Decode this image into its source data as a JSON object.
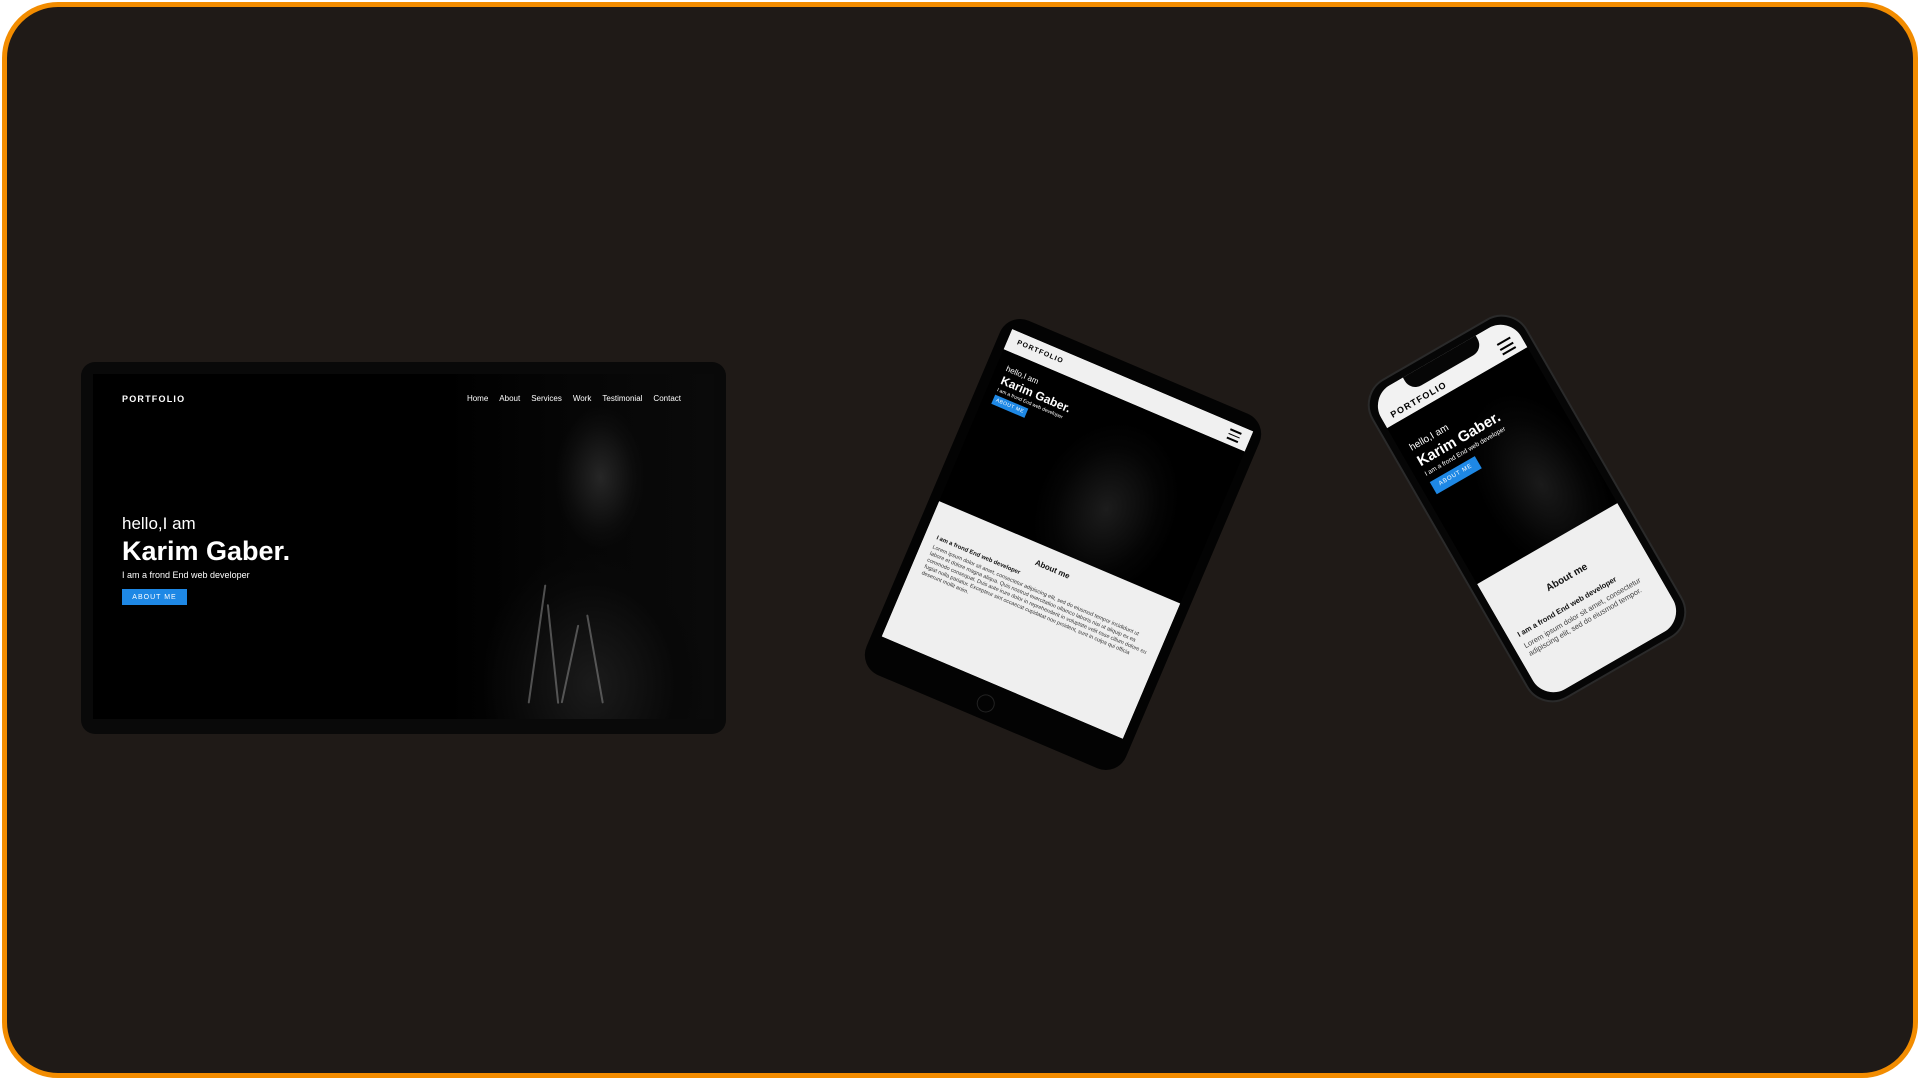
{
  "colors": {
    "frame_border": "#f28c00",
    "background": "#1f1a17",
    "accent": "#1e88e5"
  },
  "desktop": {
    "logo": "PORTFOLIO",
    "nav": [
      "Home",
      "About",
      "Services",
      "Work",
      "Testimonial",
      "Contact"
    ],
    "greeting": "hello,I am",
    "name": "Karim Gaber.",
    "subtitle": "I am a frond End web developer",
    "button": "ABOUT ME"
  },
  "tablet": {
    "logo": "PORTFOLIO",
    "greeting": "hello,I am",
    "name": "Karim Gaber.",
    "subtitle": "I am a frond End web developer",
    "button": "ABOUT ME",
    "about_title": "About me",
    "about_subtitle": "I am a frond End web developer",
    "about_text": "Lorem ipsum dolor sit amet, consectetur adipiscing elit, sed do eiusmod tempor incididunt ut labore et dolore magna aliqua. Quis nostrud exercitation ullamco laboris nisi ut aliquip ex ea commodo consequat. Duis aute irure dolor in reprehenderit in voluptate velit esse cillum dolore eu fugiat nulla pariatur. Excepteur sint occaecat cupidatat non proident, sunt in culpa qui officia deserunt mollit anim."
  },
  "phone": {
    "logo": "PORTFOLIO",
    "greeting": "hello,I am",
    "name": "Karim Gaber.",
    "subtitle": "I am a frond End web developer",
    "button": "ABOUT ME",
    "about_title": "About me",
    "about_subtitle": "I am a frond End web developer",
    "about_text": "Lorem ipsum dolor sit amet, consectetur adipiscing elit, sed do eiusmod tempor."
  }
}
